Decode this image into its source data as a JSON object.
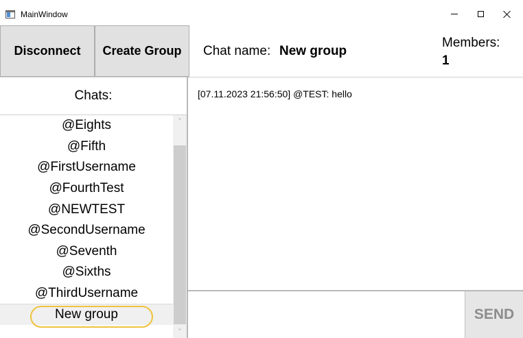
{
  "window": {
    "title": "MainWindow",
    "icon": "app-window-icon",
    "controls": [
      "minimize-icon",
      "maximize-icon",
      "close-icon"
    ]
  },
  "toolbar": {
    "disconnect_label": "Disconnect",
    "create_group_label": "Create Group"
  },
  "chat_header": {
    "name_label": "Chat name:",
    "name_value": "New group",
    "members_label": "Members:",
    "members_value": "1"
  },
  "chats": {
    "header": "Chats:",
    "items": [
      {
        "label": "@Eights"
      },
      {
        "label": "@Fifth"
      },
      {
        "label": "@FirstUsername"
      },
      {
        "label": "@FourthTest"
      },
      {
        "label": "@NEWTEST"
      },
      {
        "label": "@SecondUsername"
      },
      {
        "label": "@Seventh"
      },
      {
        "label": "@Sixths"
      },
      {
        "label": "@ThirdUsername"
      },
      {
        "label": "New group",
        "selected": true
      }
    ]
  },
  "messages": [
    {
      "text": "[07.11.2023 21:56:50] @TEST: hello"
    }
  ],
  "composer": {
    "value": "",
    "send_label": "SEND"
  },
  "colors": {
    "button_bg": "#e1e1e1",
    "selection_highlight": "#f0c23c",
    "send_text": "#8c8c8c"
  }
}
